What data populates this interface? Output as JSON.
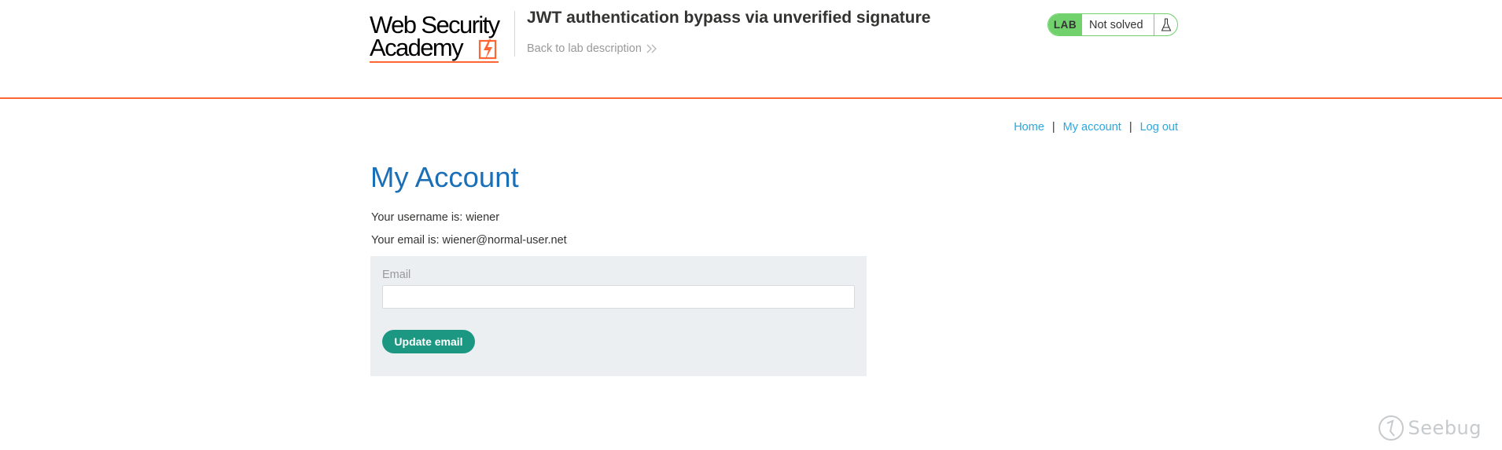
{
  "header": {
    "logo_line1": "Web Security",
    "logo_line2": "Academy",
    "lab_title": "JWT authentication bypass via unverified signature",
    "back_link": "Back to lab description",
    "lab_status": {
      "tag": "LAB",
      "state": "Not solved",
      "accent": "#70d16d"
    }
  },
  "nav": {
    "home": "Home",
    "my_account": "My account",
    "log_out": "Log out",
    "separator": "|"
  },
  "main": {
    "title": "My Account",
    "username_line": "Your username is: wiener",
    "email_line": "Your email is: wiener@normal-user.net",
    "form": {
      "email_label": "Email",
      "email_value": "",
      "submit_label": "Update email"
    }
  },
  "watermark": {
    "text": "Seebug"
  },
  "colors": {
    "brand_orange": "#ff6633",
    "title_blue": "#1b6fb7",
    "link_blue": "#29a7e1",
    "button_green": "#1c9781",
    "panel_bg": "#ebeff1"
  },
  "icons": [
    "lightning-bolt-icon",
    "chevron-double-right-icon",
    "flask-icon",
    "seebug-logo-icon"
  ]
}
